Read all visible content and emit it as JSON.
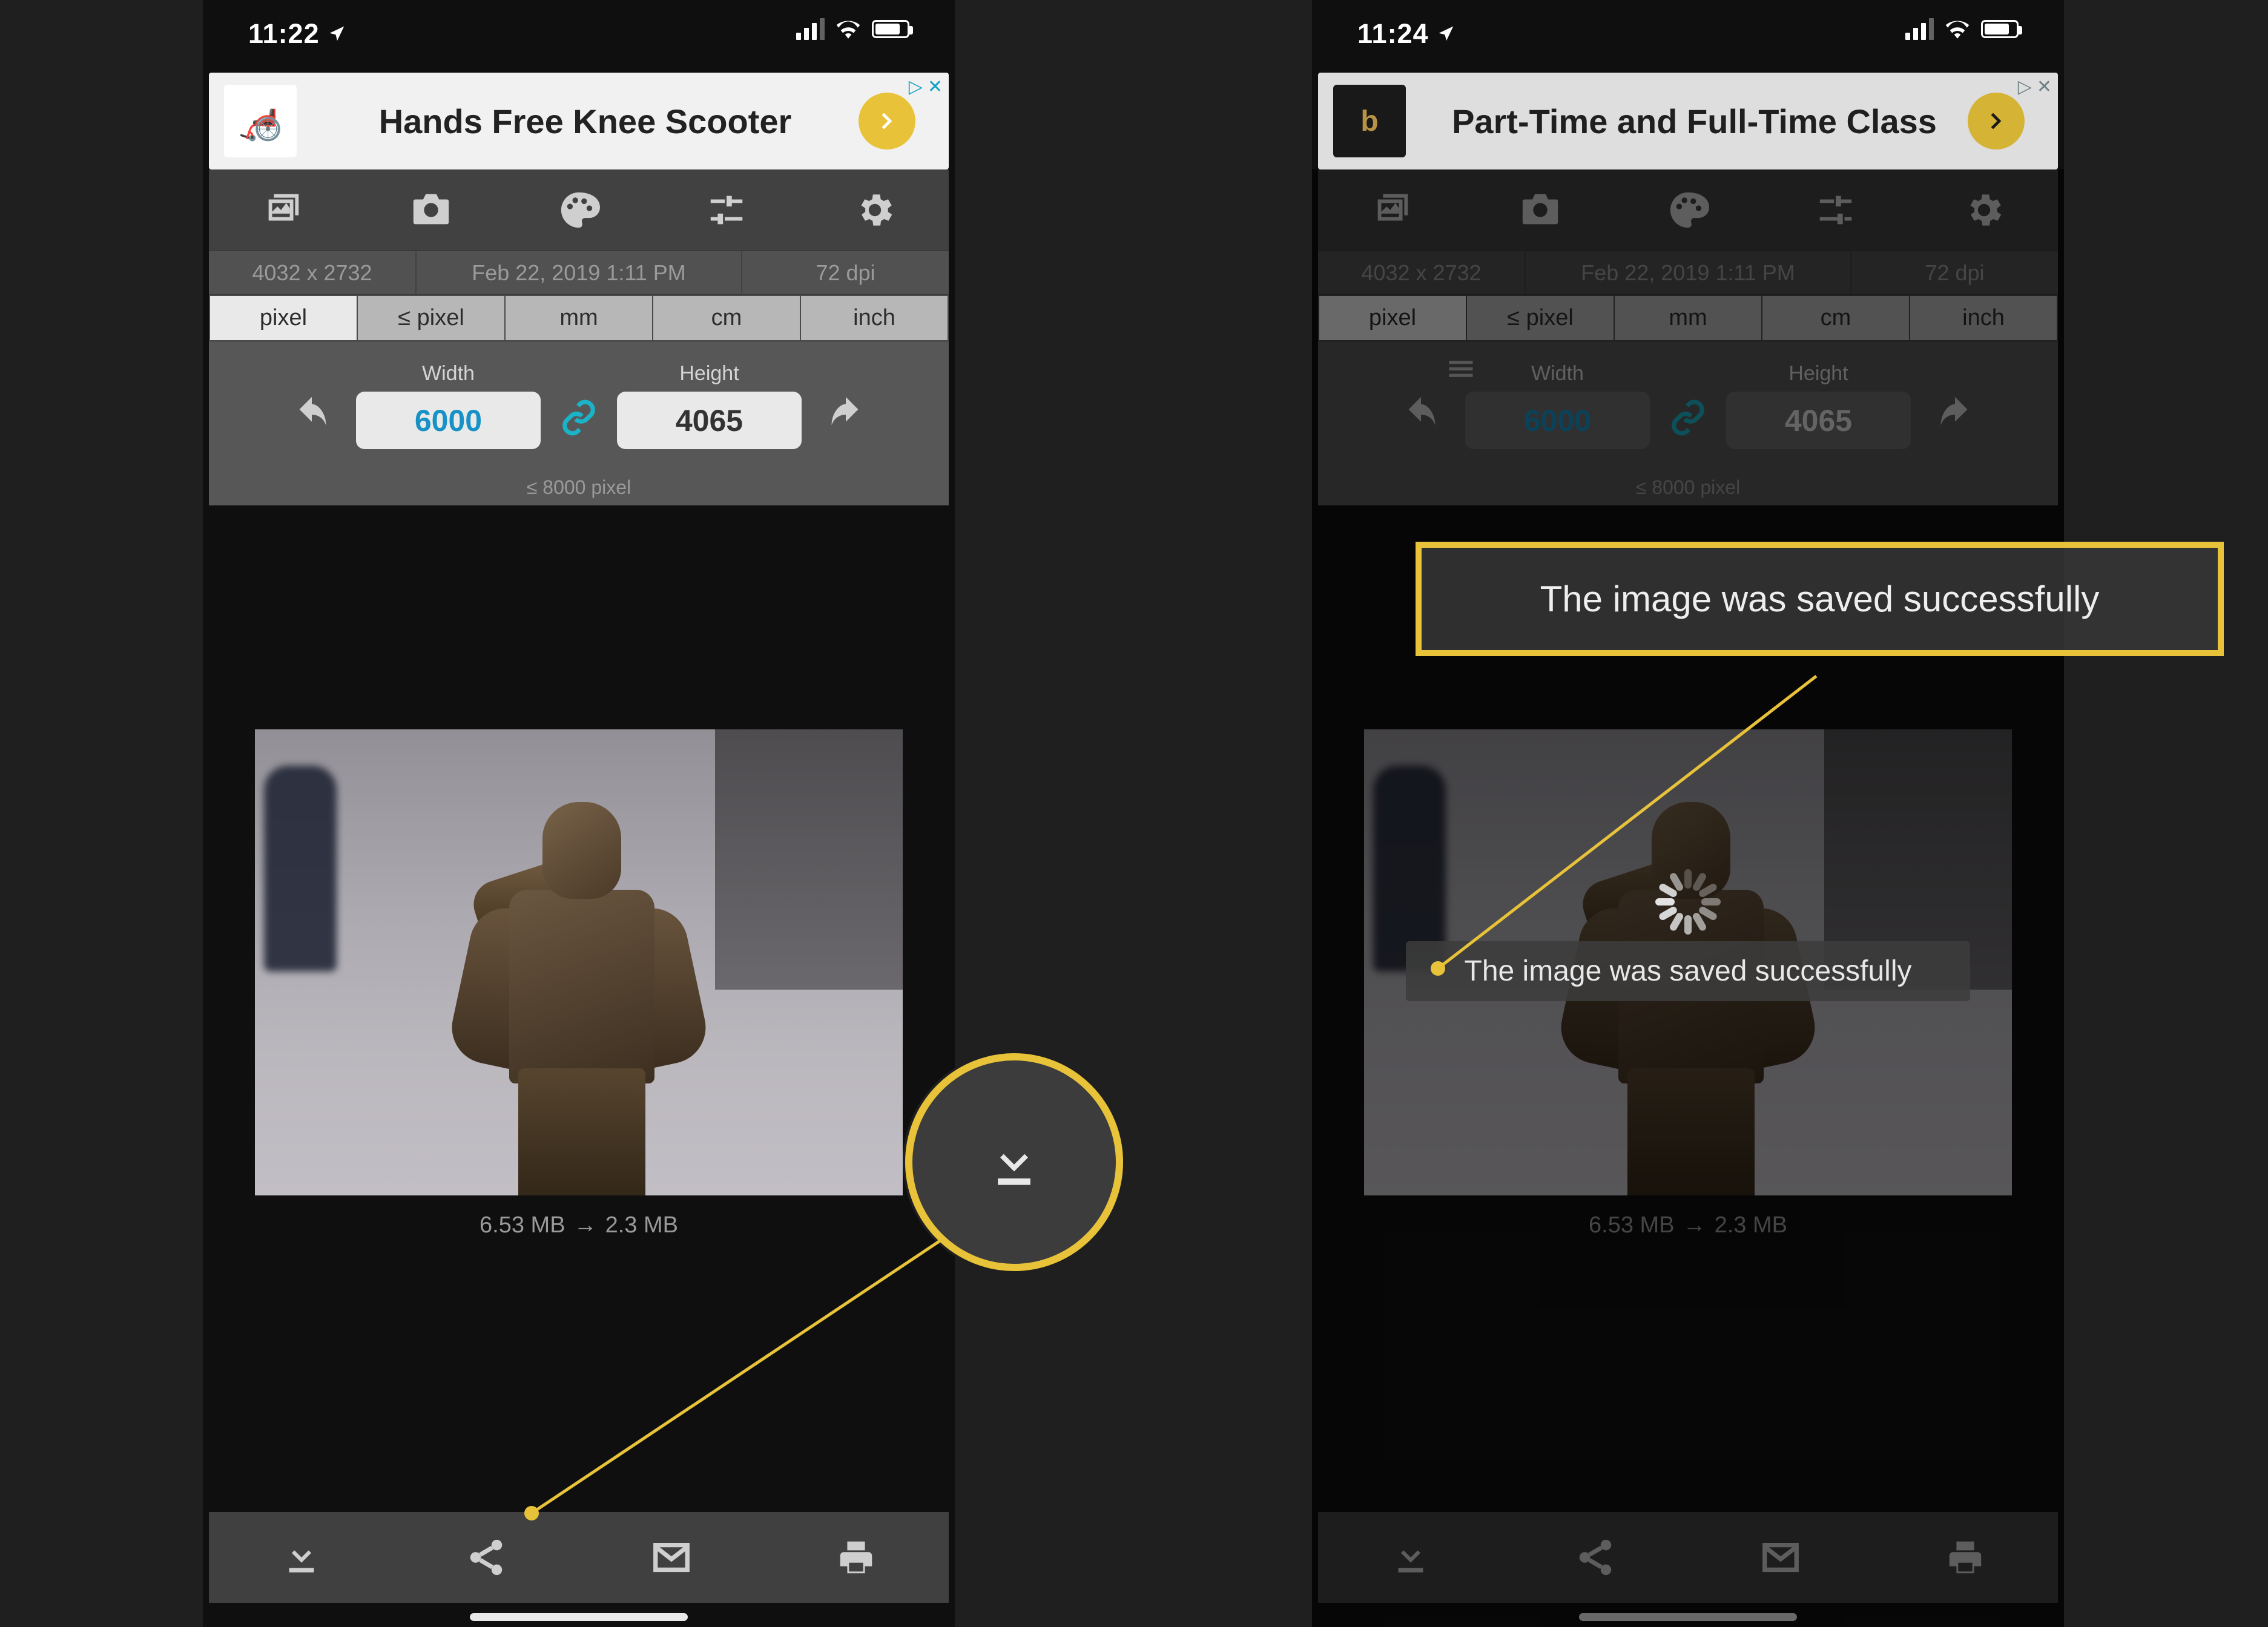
{
  "left": {
    "status": {
      "time": "11:22"
    },
    "ad": {
      "title": "Hands Free Knee Scooter"
    },
    "meta": {
      "dimensions": "4032 x 2732",
      "date": "Feb 22, 2019 1:11 PM",
      "dpi": "72 dpi"
    },
    "units": [
      "pixel",
      "≤ pixel",
      "mm",
      "cm",
      "inch"
    ],
    "units_active_index": 0,
    "dim": {
      "width_label": "Width",
      "height_label": "Height",
      "width": "6000",
      "height": "4065",
      "max": "≤ 8000 pixel"
    },
    "size": {
      "before": "6.53 MB",
      "after": "2.3 MB"
    }
  },
  "right": {
    "status": {
      "time": "11:24"
    },
    "ad": {
      "title": "Part-Time and Full-Time Class"
    },
    "meta": {
      "dimensions": "4032 x 2732",
      "date": "Feb 22, 2019 1:11 PM",
      "dpi": "72 dpi"
    },
    "units": [
      "pixel",
      "≤ pixel",
      "mm",
      "cm",
      "inch"
    ],
    "units_active_index": 0,
    "dim": {
      "width_label": "Width",
      "height_label": "Height",
      "width": "6000",
      "height": "4065",
      "max": "≤ 8000 pixel"
    },
    "size": {
      "before": "6.53 MB",
      "after": "2.3 MB"
    },
    "toast": "The image was saved successfully"
  },
  "callout": {
    "box_text": "The image was saved successfully"
  }
}
